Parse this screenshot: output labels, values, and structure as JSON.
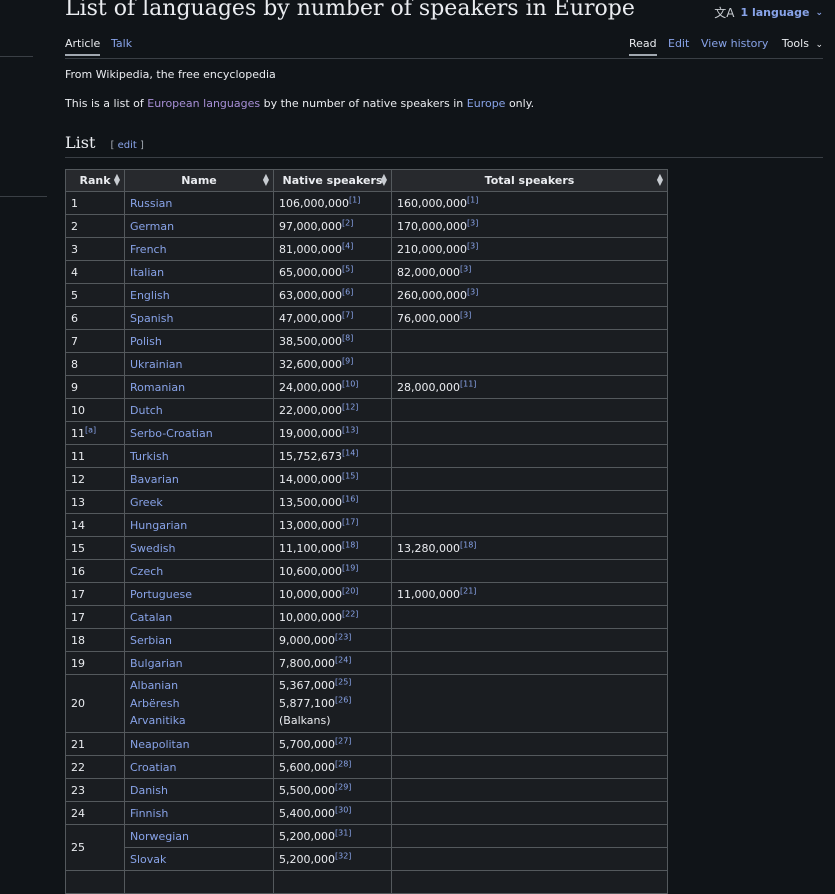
{
  "page": {
    "title": "List of languages by number of speakers in Europe",
    "language_button": "1 language",
    "tabs_left": [
      "Article",
      "Talk"
    ],
    "tabs_right": [
      "Read",
      "Edit",
      "View history"
    ],
    "tools_label": "Tools",
    "tagline": "From Wikipedia, the free encyclopedia",
    "intro": {
      "pre": "This is a list of ",
      "link1": "European languages",
      "mid": " by the number of native speakers in ",
      "link2": "Europe",
      "post": " only."
    },
    "section": {
      "title": "List",
      "edit": "edit"
    }
  },
  "table": {
    "headers": [
      "Rank",
      "Name",
      "Native speakers",
      "Total speakers"
    ],
    "rows": [
      {
        "rank": "1",
        "name": "Russian",
        "native": "106,000,000",
        "nref": "[1]",
        "total": "160,000,000",
        "tref": "[1]"
      },
      {
        "rank": "2",
        "name": "German",
        "native": "97,000,000",
        "nref": "[2]",
        "total": "170,000,000",
        "tref": "[3]"
      },
      {
        "rank": "3",
        "name": "French",
        "native": "81,000,000",
        "nref": "[4]",
        "total": "210,000,000",
        "tref": "[3]"
      },
      {
        "rank": "4",
        "name": "Italian",
        "native": "65,000,000",
        "nref": "[5]",
        "total": "82,000,000",
        "tref": "[3]"
      },
      {
        "rank": "5",
        "name": "English",
        "native": "63,000,000",
        "nref": "[6]",
        "total": "260,000,000",
        "tref": "[3]"
      },
      {
        "rank": "6",
        "name": "Spanish",
        "native": "47,000,000",
        "nref": "[7]",
        "total": "76,000,000",
        "tref": "[3]"
      },
      {
        "rank": "7",
        "name": "Polish",
        "native": "38,500,000",
        "nref": "[8]",
        "total": "",
        "tref": ""
      },
      {
        "rank": "8",
        "name": "Ukrainian",
        "native": "32,600,000",
        "nref": "[9]",
        "total": "",
        "tref": ""
      },
      {
        "rank": "9",
        "name": "Romanian",
        "native": "24,000,000",
        "nref": "[10]",
        "total": "28,000,000",
        "tref": "[11]"
      },
      {
        "rank": "10",
        "name": "Dutch",
        "native": "22,000,000",
        "nref": "[12]",
        "total": "",
        "tref": ""
      },
      {
        "rank": "11",
        "rankref": "[a]",
        "name": "Serbo-Croatian",
        "native": "19,000,000",
        "nref": "[13]",
        "total": "",
        "tref": ""
      },
      {
        "rank": "11",
        "name": "Turkish",
        "native": "15,752,673",
        "nref": "[14]",
        "total": "",
        "tref": ""
      },
      {
        "rank": "12",
        "name": "Bavarian",
        "native": "14,000,000",
        "nref": "[15]",
        "total": "",
        "tref": ""
      },
      {
        "rank": "13",
        "name": "Greek",
        "native": "13,500,000",
        "nref": "[16]",
        "total": "",
        "tref": ""
      },
      {
        "rank": "14",
        "name": "Hungarian",
        "native": "13,000,000",
        "nref": "[17]",
        "total": "",
        "tref": ""
      },
      {
        "rank": "15",
        "name": "Swedish",
        "native": "11,100,000",
        "nref": "[18]",
        "total": "13,280,000",
        "tref": "[18]"
      },
      {
        "rank": "16",
        "name": "Czech",
        "native": "10,600,000",
        "nref": "[19]",
        "total": "",
        "tref": ""
      },
      {
        "rank": "17",
        "name": "Portuguese",
        "native": "10,000,000",
        "nref": "[20]",
        "total": "11,000,000",
        "tref": "[21]"
      },
      {
        "rank": "17",
        "name": "Catalan",
        "native": "10,000,000",
        "nref": "[22]",
        "total": "",
        "tref": ""
      },
      {
        "rank": "18",
        "name": "Serbian",
        "native": "9,000,000",
        "nref": "[23]",
        "total": "",
        "tref": ""
      },
      {
        "rank": "19",
        "name": "Bulgarian",
        "native": "7,800,000",
        "nref": "[24]",
        "total": "",
        "tref": ""
      }
    ],
    "row20": {
      "rank": "20",
      "names": [
        "Albanian",
        "Arbëresh",
        "Arvanitika"
      ],
      "native": [
        {
          "v": "5,367,000",
          "r": "[25]"
        },
        {
          "v": "5,877,100",
          "r": "[26]"
        },
        {
          "v": "(Balkans)",
          "r": ""
        }
      ]
    },
    "rows_after": [
      {
        "rank": "21",
        "name": "Neapolitan",
        "native": "5,700,000",
        "nref": "[27]"
      },
      {
        "rank": "22",
        "name": "Croatian",
        "native": "5,600,000",
        "nref": "[28]"
      },
      {
        "rank": "23",
        "name": "Danish",
        "native": "5,500,000",
        "nref": "[29]"
      },
      {
        "rank": "24",
        "name": "Finnish",
        "native": "5,400,000",
        "nref": "[30]"
      }
    ],
    "row25": {
      "rank": "25",
      "items": [
        {
          "name": "Norwegian",
          "native": "5,200,000",
          "nref": "[31]"
        },
        {
          "name": "Slovak",
          "native": "5,200,000",
          "nref": "[32]"
        }
      ]
    }
  }
}
